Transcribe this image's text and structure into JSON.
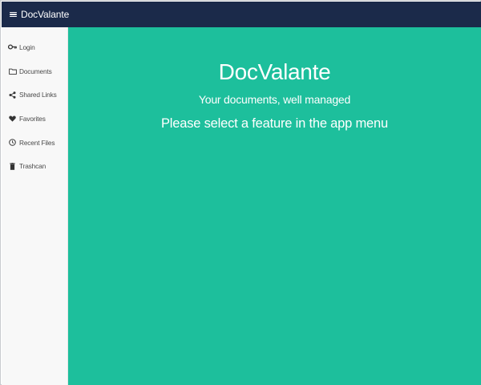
{
  "header": {
    "menu_icon": "hamburger-icon",
    "app_name": "DocValante"
  },
  "sidebar": {
    "items": [
      {
        "label": "Login",
        "icon": "key-icon"
      },
      {
        "label": "Documents",
        "icon": "folder-icon"
      },
      {
        "label": "Shared Links",
        "icon": "share-icon"
      },
      {
        "label": "Favorites",
        "icon": "heart-icon"
      },
      {
        "label": "Recent Files",
        "icon": "clock-icon"
      },
      {
        "label": "Trashcan",
        "icon": "trash-icon"
      }
    ]
  },
  "main": {
    "brand": "DocValante",
    "tagline": "Your documents, well managed",
    "prompt": "Please select a feature in the app menu"
  },
  "colors": {
    "header_bg": "#1b2a4a",
    "main_bg": "#1dbf9c",
    "sidebar_bg": "#f8f8f8",
    "text_on_dark": "#ffffff",
    "sidebar_text": "#4a4a4a"
  }
}
